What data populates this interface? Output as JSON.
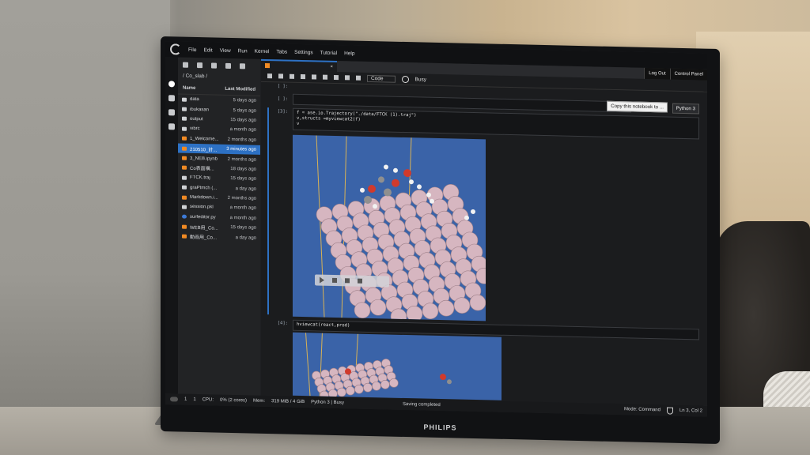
{
  "monitor": {
    "brand": "PHILIPS"
  },
  "menubar": {
    "items": [
      "File",
      "Edit",
      "View",
      "Run",
      "Kernel",
      "Tabs",
      "Settings",
      "Tutorial",
      "Help"
    ]
  },
  "filebrowser": {
    "path": "/ Co_slab /",
    "col_name": "Name",
    "col_modified": "Last Modified",
    "files": [
      {
        "name": "data",
        "modified": "5 days ago",
        "type": "folder"
      },
      {
        "name": "ibukasan",
        "modified": "5 days ago",
        "type": "folder"
      },
      {
        "name": "output",
        "modified": "15 days ago",
        "type": "folder"
      },
      {
        "name": "vibrc",
        "modified": "a month ago",
        "type": "folder"
      },
      {
        "name": "1_Welcome...",
        "modified": "2 months ago",
        "type": "notebook"
      },
      {
        "name": "210510_計...",
        "modified": "3 minutes ago",
        "type": "notebook",
        "selected": true
      },
      {
        "name": "3_NEB.ipynb",
        "modified": "2 months ago",
        "type": "notebook"
      },
      {
        "name": "Co表面構...",
        "modified": "18 days ago",
        "type": "notebook"
      },
      {
        "name": "FTCK.traj",
        "modified": "15 days ago",
        "type": "file"
      },
      {
        "name": "graPtmch (...",
        "modified": "a day ago",
        "type": "file"
      },
      {
        "name": "Markdown.i...",
        "modified": "2 months ago",
        "type": "notebook"
      },
      {
        "name": "session.pkl",
        "modified": "a month ago",
        "type": "file"
      },
      {
        "name": "surfeditor.py",
        "modified": "a month ago",
        "type": "python"
      },
      {
        "name": "WEB用_Co...",
        "modified": "15 days ago",
        "type": "notebook"
      },
      {
        "name": "動画用_Co...",
        "modified": "a day ago",
        "type": "notebook"
      }
    ]
  },
  "topbar": {
    "logout": "Log Out",
    "control_panel": "Control Panel",
    "tab_close": "×"
  },
  "notebook": {
    "cell_type": "Code",
    "kernel_status": "Busy",
    "copy_button": "Copy this notebook to ...",
    "kernel_name": "Python 3",
    "cells": [
      {
        "prompt": "[ ]:",
        "code": ""
      },
      {
        "prompt": "[ ]:",
        "code": ""
      },
      {
        "prompt": "[3]:",
        "code": "f = ase.io.Trajectory(\"./data/FTCK (1).traj\")\nv,structs =myviewcat2(f)\nv"
      },
      {
        "prompt": "[4]:",
        "code": "hviewcat(react,prod)"
      }
    ]
  },
  "status": {
    "cpu": "CPU:",
    "cpu_value": "0% (2 cores)",
    "mem": "Mem:",
    "mem_value": "319 MiB / 4 GiB",
    "kernel": "Python 3 | Busy",
    "saving": "Saving completed",
    "mode": "Mode: Command",
    "position": "Ln 3, Col 2",
    "count_a": "1",
    "count_b": "1"
  },
  "colors": {
    "accent": "#2d71c4",
    "viewer_bg": "#3a63a8",
    "atom": "#d6b6c0",
    "oxygen": "#d03a2c"
  }
}
